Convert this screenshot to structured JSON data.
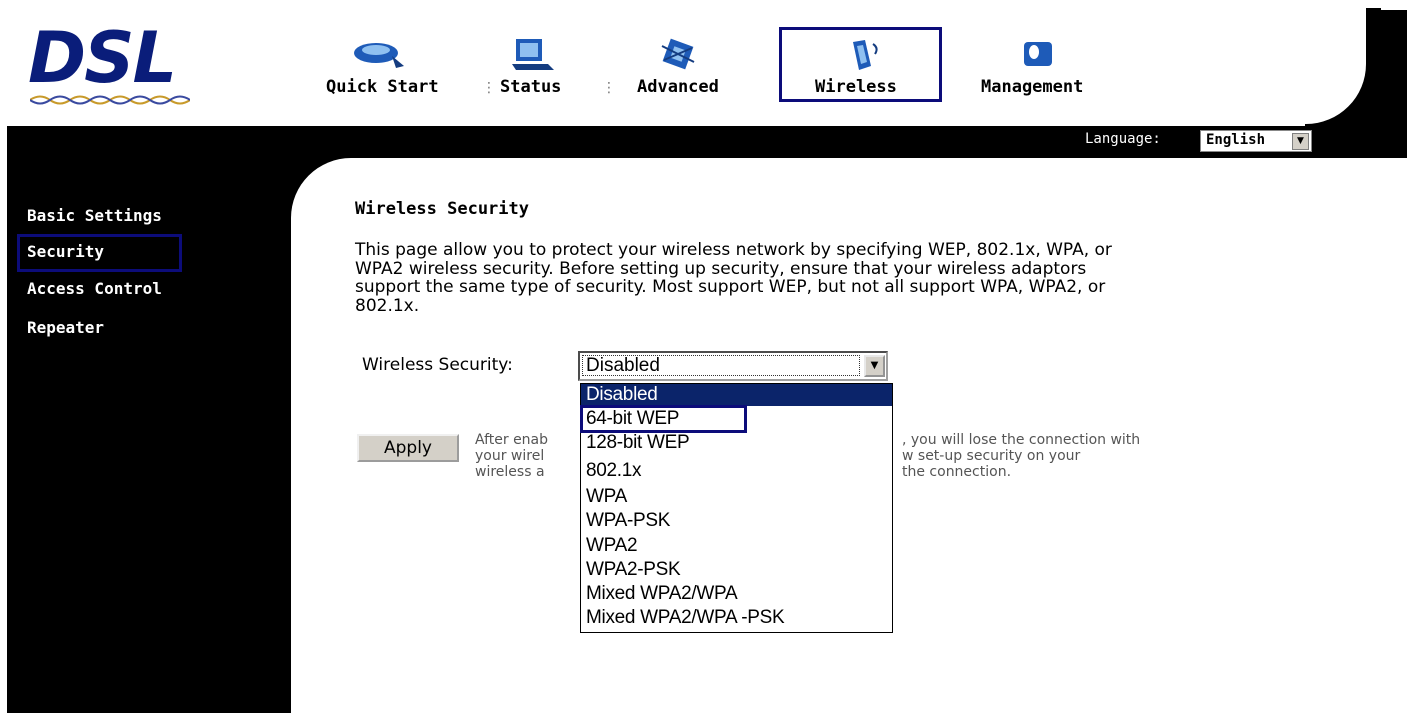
{
  "logo": {
    "text": "DSL"
  },
  "nav": {
    "tabs": [
      {
        "label": "Quick Start"
      },
      {
        "label": "Status"
      },
      {
        "label": "Advanced"
      },
      {
        "label": "Wireless"
      },
      {
        "label": "Management"
      }
    ],
    "active_tab": "Wireless"
  },
  "language": {
    "label": "Language:",
    "value": "English"
  },
  "sidebar": {
    "items": [
      {
        "label": "Basic Settings"
      },
      {
        "label": "Security"
      },
      {
        "label": "Access Control"
      },
      {
        "label": "Repeater"
      }
    ],
    "active_item": "Security"
  },
  "main": {
    "title": "Wireless Security",
    "intro_lines": [
      "This page allow you to protect your wireless network by specifying WEP, 802.1x, WPA, or",
      "WPA2 wireless security. Before setting up security, ensure that your wireless adaptors",
      "support the same type of security. Most support WEP, but not all support WPA, WPA2, or",
      "802.1x."
    ],
    "security_label": "Wireless Security:",
    "security_value": "Disabled",
    "security_options": [
      "Disabled",
      "64-bit WEP",
      "128-bit WEP",
      "802.1x",
      "WPA",
      "WPA-PSK",
      "WPA2",
      "WPA2-PSK",
      "Mixed WPA2/WPA",
      "Mixed WPA2/WPA -PSK"
    ],
    "apply_label": "Apply",
    "after_lines": [
      "After enab",
      "your wirel",
      "wireless a"
    ],
    "after_right_lines": [
      ", you will lose the connection with",
      "w set-up security on your",
      " the connection."
    ]
  },
  "colors": {
    "highlight_box": "#0c0c7a",
    "option_highlight": "#0b246a",
    "logo": "#0a1d7a"
  }
}
